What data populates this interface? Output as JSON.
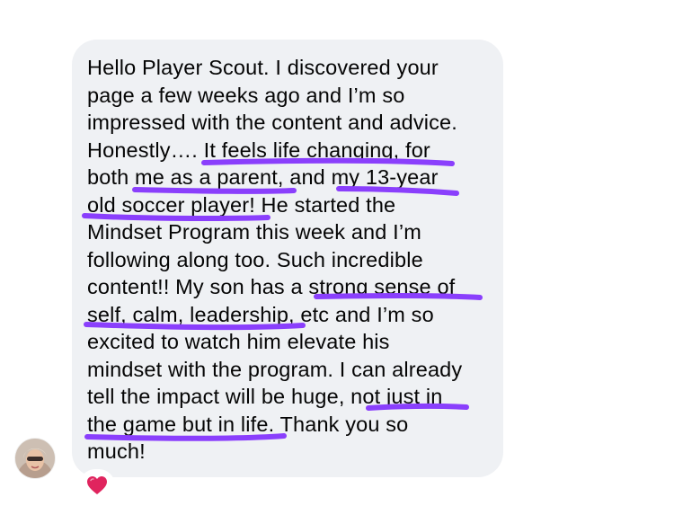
{
  "message": {
    "lines": [
      "Hello Player Scout. I discovered your",
      "page a few weeks ago and I’m so",
      "impressed with the content and advice.",
      "Honestly…. It feels life changing, for",
      "both me as a parent, and my 13-year",
      "old soccer player! He started the",
      "Mindset Program this week and I’m",
      "following along too. Such incredible",
      "content!! My son has a strong sense of",
      "self, calm, leadership, etc and I’m so",
      "excited to watch him elevate his",
      "mindset with the program. I can already",
      "tell the impact will be huge, not just in",
      "the game but in life. Thank you so",
      "much!"
    ],
    "highlighted_phrases": [
      "It feels life changing, for",
      "me as a parent,",
      "my 13-year",
      "old soccer player!",
      "strong sense of",
      "self, calm, leadership,",
      "not just in",
      "the game but in life."
    ]
  },
  "reaction": {
    "icon": "red-heart-icon",
    "color": "#e0245e"
  },
  "highlight_color": "#8a3ffc",
  "sender": {
    "avatar": "profile-photo"
  }
}
